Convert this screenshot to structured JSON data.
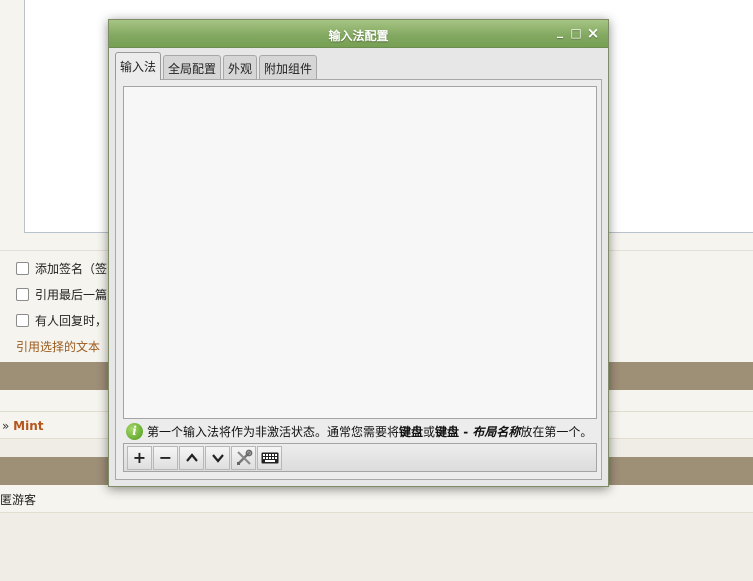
{
  "background": {
    "options": [
      {
        "label": "添加签名（签"
      },
      {
        "label": "引用最后一篇"
      },
      {
        "label": "有人回复时，"
      }
    ],
    "quote_selected": "引用选择的文本",
    "breadcrumb_sep": "»",
    "breadcrumb_link": "Mint",
    "guest_text": "匿游客"
  },
  "window": {
    "title": "输入法配置",
    "controls": {
      "minimize": "_",
      "maximize": "□",
      "close": "×"
    }
  },
  "tabs": [
    {
      "label": "输入法"
    },
    {
      "label": "全局配置"
    },
    {
      "label": "外观"
    },
    {
      "label": "附加组件"
    }
  ],
  "info": {
    "icon_glyph": "i",
    "text_1": "第一个输入法将作为非激活状态。通常您需要将",
    "bold_1": "键盘",
    "text_2": "或",
    "bold_2": "键盘 - ",
    "italic_1": "布局名称",
    "text_3": "放在第一个。"
  },
  "toolbar": {
    "add": "+",
    "remove": "−"
  },
  "colors": {
    "titlebar": "#84a962",
    "link": "#b5561d",
    "bar": "#9e8f77"
  }
}
